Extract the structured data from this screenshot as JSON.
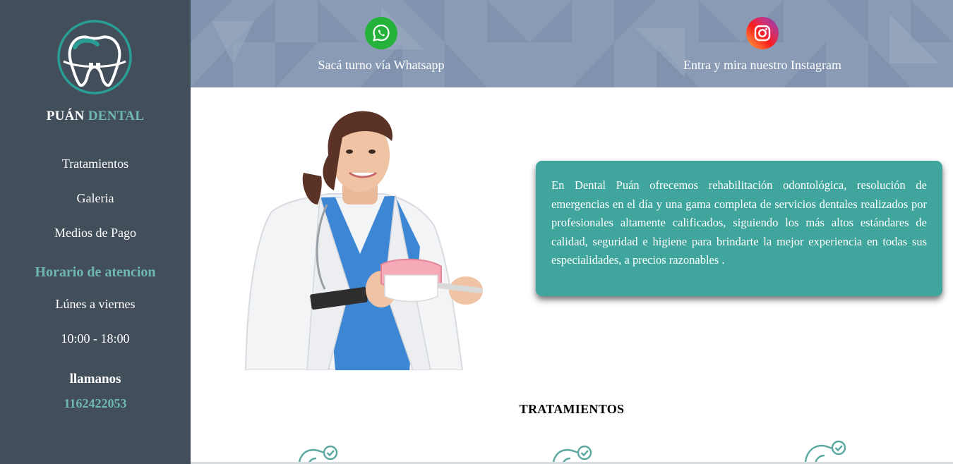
{
  "sidebar": {
    "brand_first": "PUÁN",
    "brand_second": "DENTAL",
    "nav": [
      {
        "label": "Tratamientos"
      },
      {
        "label": "Galeria"
      },
      {
        "label": "Medios de Pago"
      }
    ],
    "hours_title": "Horario de atencion",
    "hours_days": "Lúnes a viernes",
    "hours_time": "10:00 - 18:00",
    "call_title": "llamanos",
    "phone": "1162422053"
  },
  "header": {
    "whatsapp_label": "Sacá turno vía Whatsapp",
    "instagram_label": "Entra y mira nuestro Instagram"
  },
  "main": {
    "description": "En Dental Puán ofrecemos rehabilitación odontológica, resolución de emergencias en el día y una gama completa de servicios dentales realizados por profesionales altamente calificados, siguiendo los más altos estándares de calidad, seguridad e higiene para brindarte la mejor experiencia en todas sus especialidades, a precios razonables .",
    "section_title": "TRATAMIENTOS"
  },
  "icons": [
    "tooth-logo-icon",
    "whatsapp-icon",
    "instagram-icon",
    "tooth-check-icon"
  ],
  "colors": {
    "sidebar_bg": "#434e5b",
    "accent_teal": "#6fb8b0",
    "card_bg": "#3fa59d",
    "header_bg": "#8a9bb5"
  }
}
